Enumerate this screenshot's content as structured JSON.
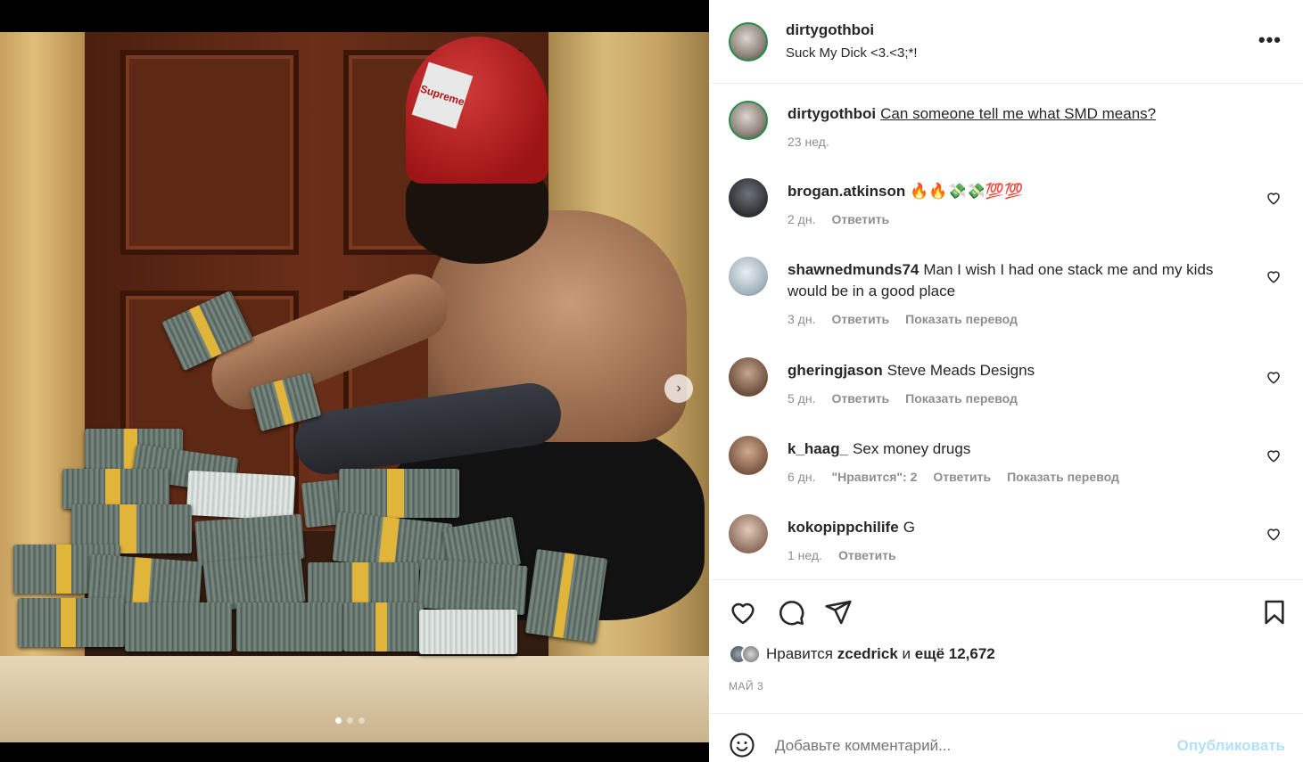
{
  "post": {
    "username": "dirtygothboi",
    "subtitle": "Suck My Dick <3.<3;*!",
    "more_label": "•••"
  },
  "media": {
    "hat_text": "Supreme",
    "carousel_next": "›",
    "carousel_total": 3,
    "carousel_active": 1
  },
  "caption": {
    "username": "dirtygothboi",
    "text": "Can someone tell me what SMD means?",
    "time": "23 нед."
  },
  "comments": [
    {
      "username": "brogan.atkinson",
      "text": "🔥🔥💸💸💯💯",
      "time": "2 дн.",
      "reply": "Ответить",
      "translate": "",
      "likes": ""
    },
    {
      "username": "shawnedmunds74",
      "text": "Man I wish I had one stack me and my kids would be in a good place",
      "time": "3 дн.",
      "reply": "Ответить",
      "translate": "Показать перевод",
      "likes": ""
    },
    {
      "username": "gheringjason",
      "text": "Steve Meads Designs",
      "time": "5 дн.",
      "reply": "Ответить",
      "translate": "Показать перевод",
      "likes": ""
    },
    {
      "username": "k_haag_",
      "text": "Sex money drugs",
      "time": "6 дн.",
      "reply": "Ответить",
      "translate": "Показать перевод",
      "likes": "\"Нравится\": 2"
    },
    {
      "username": "kokopippchilife",
      "text": "G",
      "time": "1 нед.",
      "reply": "Ответить",
      "translate": "",
      "likes": ""
    }
  ],
  "likes": {
    "prefix": "Нравится",
    "user": "zcedrick",
    "middle": "и",
    "count": "ещё 12,672"
  },
  "date": "МАЙ 3",
  "add_comment": {
    "placeholder": "Добавьте комментарий...",
    "publish": "Опубликовать"
  }
}
